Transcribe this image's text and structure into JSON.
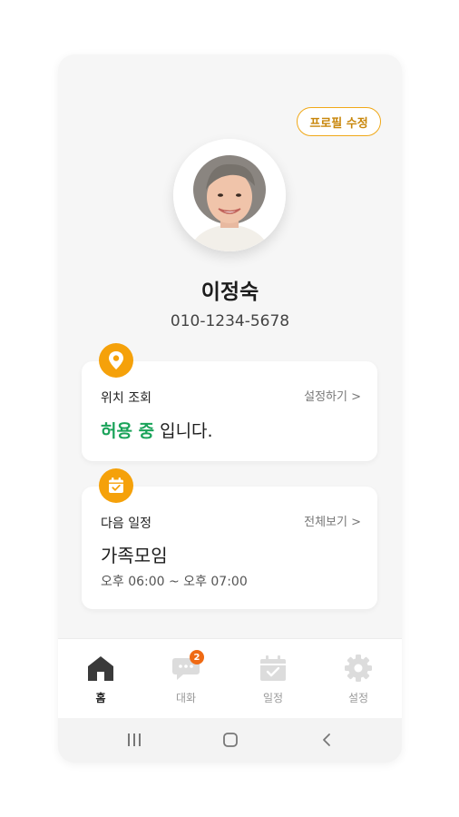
{
  "header": {
    "edit_profile_label": "프로필 수정"
  },
  "profile": {
    "name": "이정숙",
    "phone": "010-1234-5678"
  },
  "location_card": {
    "title": "위치 조회",
    "link": "설정하기 >",
    "status_highlight": "허용 중",
    "status_suffix": " 입니다."
  },
  "schedule_card": {
    "title": "다음 일정",
    "link": "전체보기 >",
    "event": "가족모임",
    "time": "오후 06:00 ~ 오후 07:00"
  },
  "tabbar": {
    "tabs": [
      {
        "label": "홈",
        "icon": "home-icon",
        "active": true
      },
      {
        "label": "대화",
        "icon": "chat-icon",
        "badge": "2"
      },
      {
        "label": "일정",
        "icon": "calendar-icon"
      },
      {
        "label": "설정",
        "icon": "gear-icon"
      }
    ]
  },
  "colors": {
    "accent": "#f5a10a",
    "success": "#1aa35a",
    "badge": "#ef6a14"
  }
}
